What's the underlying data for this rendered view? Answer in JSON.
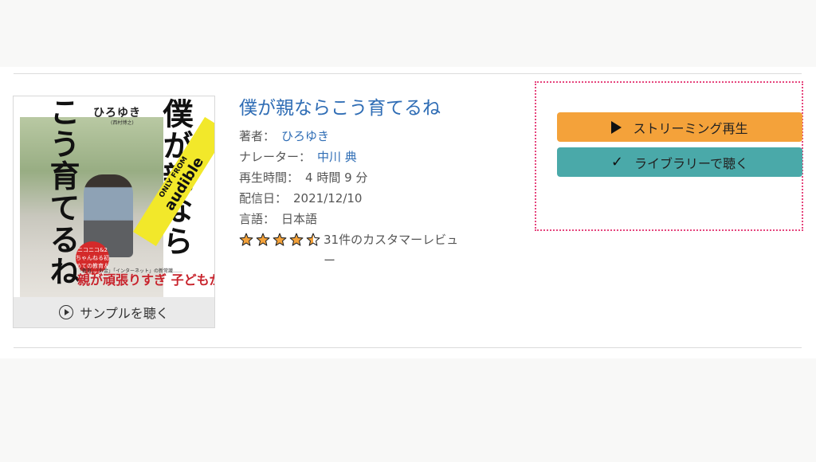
{
  "product": {
    "title": "僕が親ならこう育てるね",
    "author_label": "著者：",
    "author": "ひろゆき",
    "narrator_label": "ナレーター：",
    "narrator": "中川 典",
    "length_label": "再生時間：",
    "length": "4 時間 9 分",
    "release_label": "配信日：",
    "release_date": "2021/12/10",
    "language_label": "言語：",
    "language": "日本語",
    "rating_stars": 4.5,
    "reviews_text": "31件のカスタマーレビュー"
  },
  "cover": {
    "author": "ひろゆき",
    "author_sub": "(西村博之)",
    "title_line1": "僕が親なら",
    "title_line2": "こう育てるね",
    "badge": "ニコニコ&2ちゃんねる初めての教育＆子育て論",
    "tagline_small": "「教育」「お金」「インターネット」の新常識……",
    "tagline": "親が頑張りすぎ 子どもがバカ",
    "ribbon_top": "ONLY FROM",
    "ribbon_bottom": "audible"
  },
  "sample_button": "サンプルを聴く",
  "actions": {
    "stream_label": "ストリーミング再生",
    "library_label": "ライブラリーで聴く"
  },
  "colors": {
    "link": "#2f6db5",
    "stream_button": "#f4a23a",
    "library_button": "#4aa9a9",
    "dotted_outline": "#e6457d",
    "star": "#f4a23a"
  }
}
